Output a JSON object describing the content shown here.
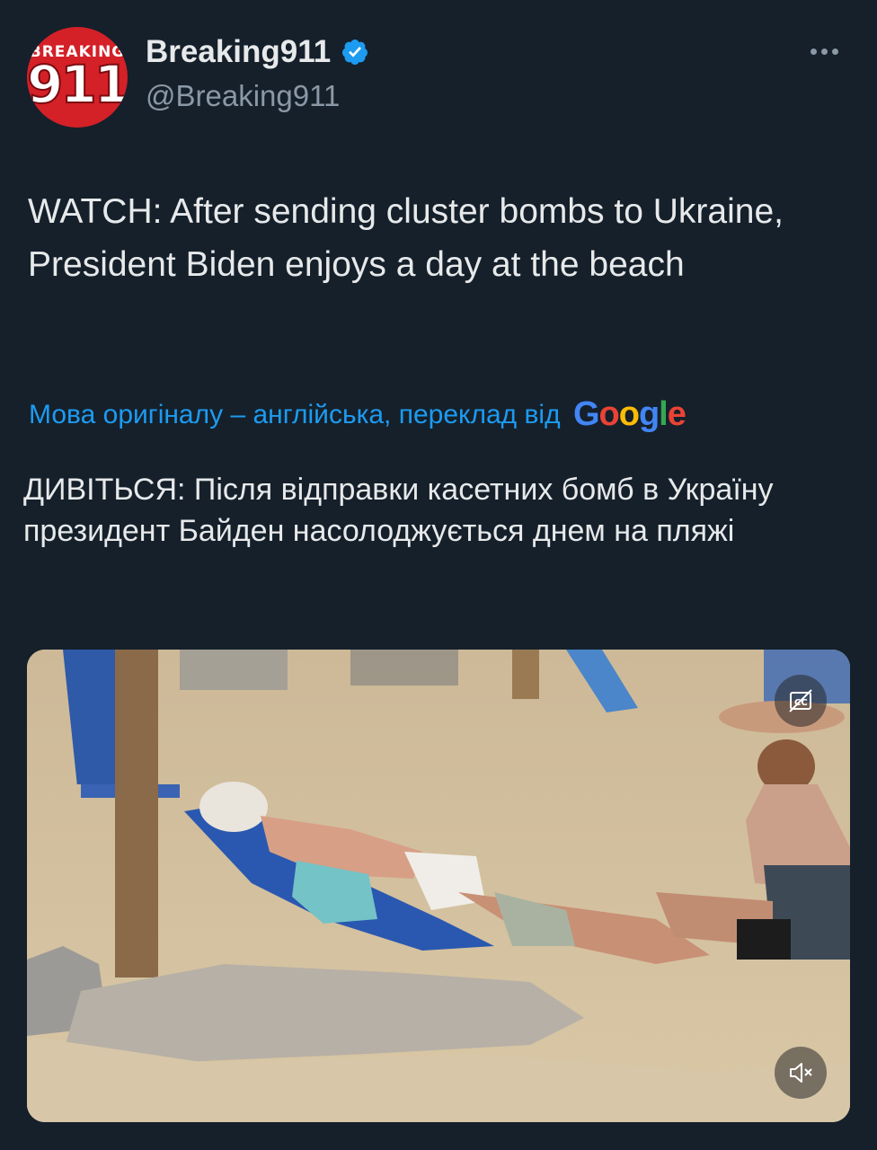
{
  "author": {
    "avatar_top_text": "BREAKING",
    "avatar_num": "911",
    "display_name": "Breaking911",
    "handle": "@Breaking911"
  },
  "tweet": {
    "text": "WATCH: After sending cluster bombs to Ukraine, President Biden enjoys a day at the beach",
    "translate_label": "Мова оригіналу – англійська, переклад від",
    "translator_brand": "Google",
    "translated_text": "ДИВІТЬСЯ: Після відправки касетних бомб в Україну президент Байден насолоджується днем на пляжі"
  },
  "media": {
    "captions_icon": "captions-icon",
    "mute_icon": "mute-icon"
  },
  "colors": {
    "background": "#15202b",
    "link": "#1d9bf0",
    "verified": "#1d9bf0",
    "secondary_text": "#8b98a5"
  }
}
